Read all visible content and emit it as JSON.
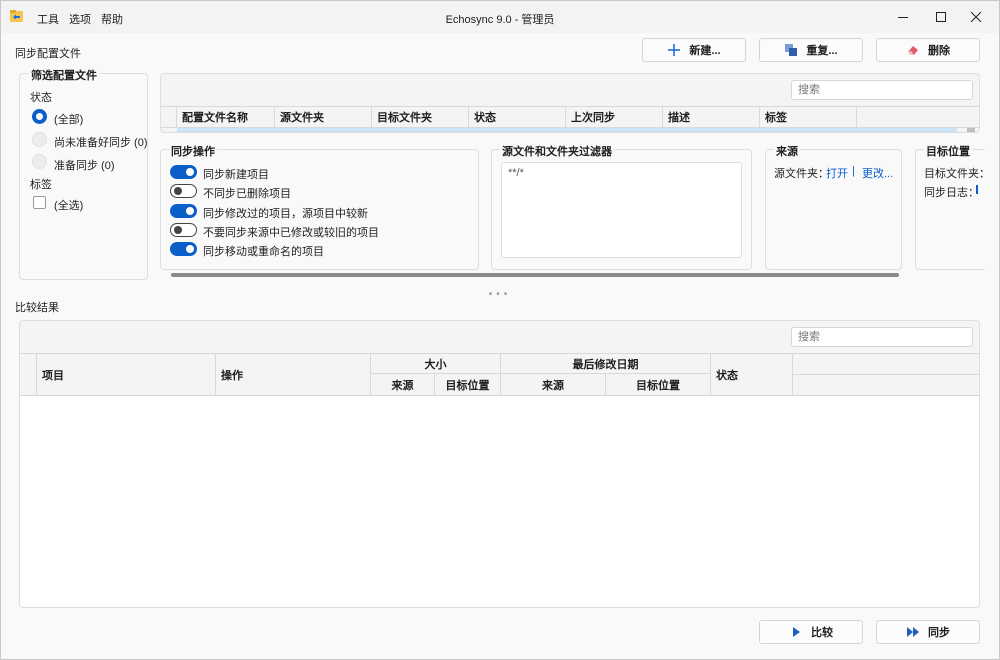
{
  "titlebar": {
    "title": "Echosync 9.0 - 管理员",
    "menus": [
      "工具",
      "选项",
      "帮助"
    ],
    "minimize_icon": "minimize-icon",
    "maximize_icon": "maximize-icon",
    "close_icon": "close-icon"
  },
  "profiles_section": {
    "label": "同步配置文件",
    "new_label": "新建...",
    "duplicate_label": "重复...",
    "delete_label": "删除"
  },
  "filter": {
    "title": "筛选配置文件",
    "status_label": "状态",
    "options": [
      "(全部)",
      "尚未准备好同步 (0)",
      "准备同步 (0)"
    ],
    "tags_label": "标签",
    "tag_all": "(全选)"
  },
  "profiles_grid": {
    "search_placeholder": "搜索",
    "columns": [
      "配置文件名称",
      "源文件夹",
      "目标文件夹",
      "状态",
      "上次同步",
      "描述",
      "标签"
    ]
  },
  "sync_ops": {
    "title": "同步操作",
    "items": [
      {
        "label": "同步新建项目",
        "on": true
      },
      {
        "label": "不同步已删除项目",
        "on": false
      },
      {
        "label": "同步修改过的项目，源项目中较新",
        "on": true
      },
      {
        "label": "不要同步来源中已修改或较旧的项目",
        "on": false
      },
      {
        "label": "同步移动或重命名的项目",
        "on": true
      }
    ]
  },
  "filters_panel": {
    "title": "源文件和文件夹过滤器",
    "value": "**/*"
  },
  "source_panel": {
    "title": "来源",
    "folder_label": "源文件夹：",
    "open_link": "打开",
    "separator": "|",
    "change_link": "更改..."
  },
  "target_panel": {
    "title": "目标位置",
    "folder_label": "目标文件夹：",
    "log_label": "同步日志："
  },
  "compare_section": {
    "label": "比较结果",
    "search_placeholder": "搜索",
    "col_item": "项目",
    "col_action": "操作",
    "col_size": "大小",
    "col_modified": "最后修改日期",
    "col_status": "状态",
    "sub_source": "来源",
    "sub_target": "目标位置"
  },
  "footer": {
    "compare_label": "比较",
    "sync_label": "同步"
  },
  "colors": {
    "accent": "#0a5fc9",
    "selected_row": "#cce4f7"
  }
}
